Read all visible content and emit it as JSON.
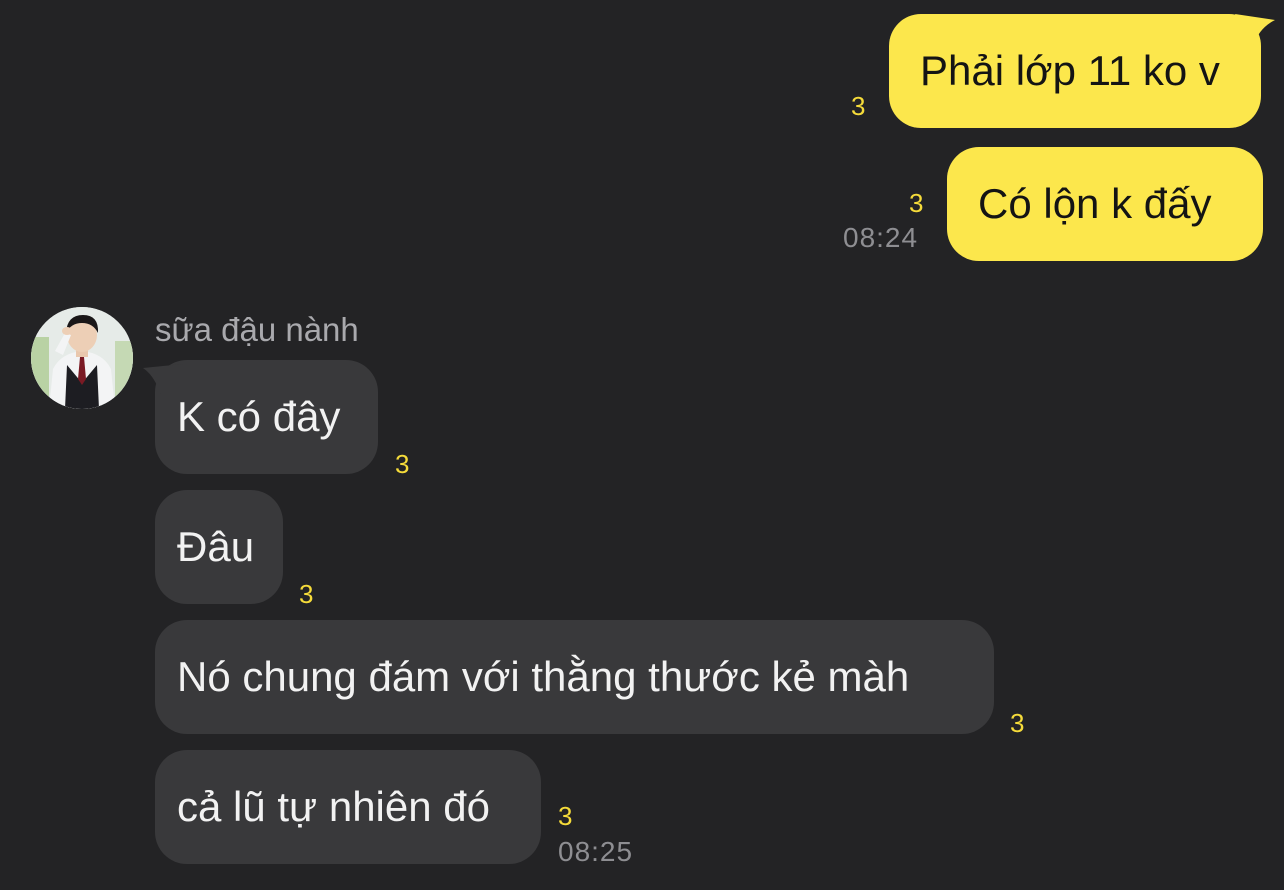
{
  "colors": {
    "background": "#232325",
    "outgoing_bubble": "#FCE74C",
    "incoming_bubble": "#39393b",
    "unread_count": "#F5DB3A",
    "timestamp": "#8e8e92"
  },
  "outgoing": [
    {
      "text": "Phải lớp 11 ko v",
      "unread": "3"
    },
    {
      "text": "Có lộn k đấy",
      "unread": "3",
      "time": "08:24"
    }
  ],
  "contact": {
    "name": "sữa đậu nành",
    "avatar_icon": "profile-photo-icon"
  },
  "incoming": [
    {
      "text": "K có đây",
      "unread": "3"
    },
    {
      "text": "Đâu",
      "unread": "3"
    },
    {
      "text": "Nó chung đám với thằng thước kẻ màh",
      "unread": "3"
    },
    {
      "text": "cả lũ tự nhiên đó",
      "unread": "3",
      "time": "08:25"
    }
  ]
}
